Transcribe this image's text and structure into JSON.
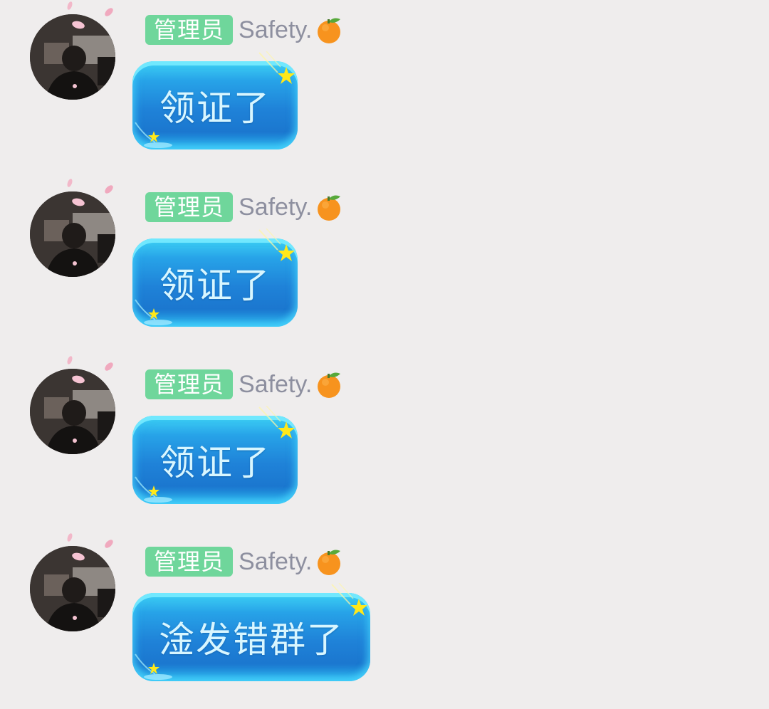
{
  "messages": [
    {
      "role_badge": "管理员",
      "nickname": "Safety.",
      "name_emoji": "tangerine-icon",
      "text": "领证了"
    },
    {
      "role_badge": "管理员",
      "nickname": "Safety.",
      "name_emoji": "tangerine-icon",
      "text": "领证了"
    },
    {
      "role_badge": "管理员",
      "nickname": "Safety.",
      "name_emoji": "tangerine-icon",
      "text": "领证了"
    },
    {
      "role_badge": "管理员",
      "nickname": "Safety.",
      "name_emoji": "tangerine-icon",
      "text": "淦发错群了"
    }
  ],
  "colors": {
    "background": "#efeded",
    "role_badge": "#6fd69b",
    "nickname": "#8d8f9f",
    "bubble": "#1f82d8",
    "bubble_text": "#d8f6ff"
  }
}
